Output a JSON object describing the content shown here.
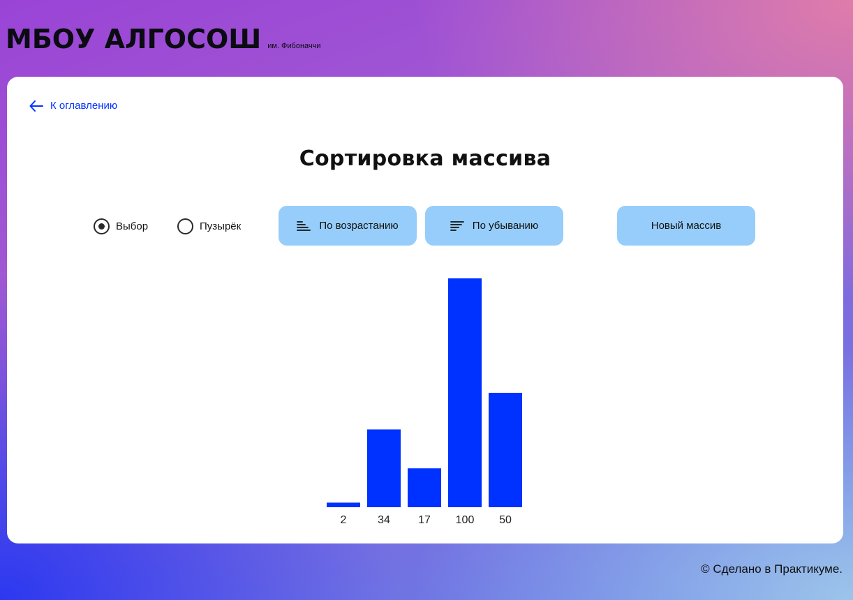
{
  "header": {
    "title": "МБОУ АЛГОСОШ",
    "subtitle": "им. Фибоначчи"
  },
  "nav": {
    "back_label": "К оглавлению"
  },
  "page": {
    "title": "Сортировка массива"
  },
  "controls": {
    "sort_method": {
      "options": [
        {
          "label": "Выбор",
          "selected": true
        },
        {
          "label": "Пузырёк",
          "selected": false
        }
      ]
    },
    "ascending_label": "По возрастанию",
    "descending_label": "По убыванию",
    "new_array_label": "Новый массив",
    "button_color": "#96cdfa"
  },
  "chart_data": {
    "type": "bar",
    "categories": [
      "2",
      "34",
      "17",
      "100",
      "50"
    ],
    "values": [
      2,
      34,
      17,
      100,
      50
    ],
    "bar_color": "#0032ff",
    "ylim": [
      0,
      100
    ]
  },
  "footer": {
    "text": "© Сделано в Практикуме."
  }
}
